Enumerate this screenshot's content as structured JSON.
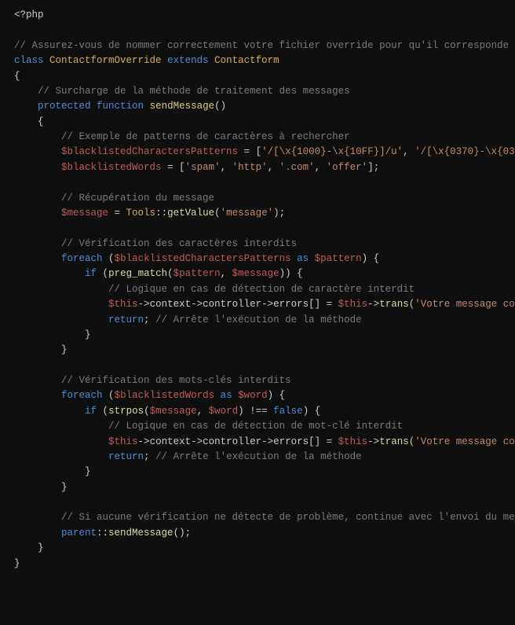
{
  "code": {
    "open": "<?php",
    "c1": "// Assurez-vous de nommer correctement votre fichier override pour qu'il corresponde ",
    "kw_class": "class",
    "clsname": "ContactformOverride",
    "kw_extends": "extends",
    "parentcls": "Contactform",
    "brace_open": "{",
    "c2": "// Surcharge de la méthode de traitement des messages",
    "kw_protected": "protected",
    "kw_function": "function",
    "m_send": "sendMessage",
    "parens": "()",
    "c3": "// Exemple de patterns de caractères à rechercher",
    "v_bcp": "$blacklistedCharactersPatterns",
    "eq": " = ",
    "arr_open": "[",
    "s_p1": "'/[\\x{1000}-\\x{10FF}]/u'",
    "comma": ", ",
    "s_p2": "'/[\\x{0370}-\\x{03",
    "v_bw": "$blacklistedWords",
    "s_spam": "'spam'",
    "s_http": "'http'",
    "s_com": "'.com'",
    "s_offer": "'offer'",
    "arr_close": "];",
    "c4": "// Récupération du message",
    "v_msg": "$message",
    "tools": "Tools",
    "dcolon": "::",
    "getval": "getValue",
    "p_open": "(",
    "s_msg": "'message'",
    "p_close_semi": ");",
    "c5": "// Vérification des caractères interdits",
    "kw_foreach": "foreach",
    "kw_as": "as",
    "v_pattern": "$pattern",
    "p_close_brace": ") {",
    "kw_if": "if",
    "pregmatch": "preg_match",
    "p_close_brace2": ")) {",
    "c6": "// Logique en cas de détection de caractère interdit",
    "v_this": "$this",
    "arrow": "->",
    "context": "context",
    "controller": "controller",
    "errors": "errors[]",
    "trans": "trans",
    "s_err": "'Votre message co",
    "kw_return": "return",
    "semi": ";",
    "c7": " // Arrête l'exécution de la méthode",
    "brace_close": "}",
    "c8": "// Vérification des mots-clés interdits",
    "v_word": "$word",
    "strpos": "strpos",
    "p_close": ")",
    "neq": " !== ",
    "kw_false": "false",
    "c9": "// Logique en cas de détection de mot-clé interdit",
    "c10": "// Si aucune vérification ne détecte de problème, continue avec l'envoi du me",
    "parent": "parent",
    "send2": "sendMessage",
    "parens_semi": "();"
  }
}
